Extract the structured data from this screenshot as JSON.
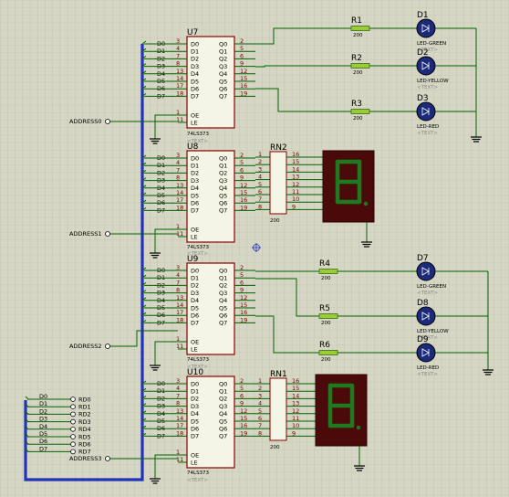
{
  "latches": [
    {
      "ref": "U7",
      "part": "74LS373",
      "text": "<TEXT>"
    },
    {
      "ref": "U8",
      "part": "74LS373",
      "text": "<TEXT>"
    },
    {
      "ref": "U9",
      "part": "74LS373",
      "text": "<TEXT>"
    },
    {
      "ref": "U10",
      "part": "74LS373",
      "text": "<TEXT>"
    }
  ],
  "latch_left_pins": [
    "D0",
    "D1",
    "D2",
    "D3",
    "D4",
    "D5",
    "D6",
    "D7"
  ],
  "latch_left_nums": [
    "3",
    "4",
    "7",
    "8",
    "13",
    "14",
    "17",
    "18"
  ],
  "latch_right_pins": [
    "Q0",
    "Q1",
    "Q2",
    "Q3",
    "Q4",
    "Q5",
    "Q6",
    "Q7"
  ],
  "latch_right_nums": [
    "2",
    "5",
    "6",
    "9",
    "12",
    "15",
    "16",
    "19"
  ],
  "oe_label": "OE",
  "le_label": "LE",
  "oe_num": "1",
  "le_num": "11",
  "bus_labels_u7": [
    "D0",
    "D1",
    "D2",
    "D3",
    "D4",
    "D5",
    "D6",
    "D7"
  ],
  "bus_labels_u8": [
    "D0",
    "D1",
    "D2",
    "D3",
    "D4",
    "D5",
    "D6",
    "D7"
  ],
  "bus_labels_u9": [
    "D0",
    "D1",
    "D2",
    "D3",
    "D4",
    "D5",
    "D6",
    "D7"
  ],
  "bus_labels_u10": [
    "D0",
    "D1",
    "D2",
    "D3",
    "D4",
    "D5",
    "D6",
    "D7"
  ],
  "address_labels": [
    "ADDRESS0",
    "ADDRESS1",
    "ADDRESS2",
    "ADDRESS3"
  ],
  "resistors": [
    {
      "ref": "R1",
      "value": "200"
    },
    {
      "ref": "R2",
      "value": "200"
    },
    {
      "ref": "R3",
      "value": "200"
    },
    {
      "ref": "R4",
      "value": "200"
    },
    {
      "ref": "R5",
      "value": "200"
    },
    {
      "ref": "R6",
      "value": "200"
    }
  ],
  "leds": [
    {
      "ref": "D1",
      "part": "LED-GREEN",
      "text": "<TEXT>",
      "color": "#1c2a7a"
    },
    {
      "ref": "D2",
      "part": "LED-YELLOW",
      "text": "<TEXT>",
      "color": "#1c2a7a"
    },
    {
      "ref": "D3",
      "part": "LED-RED",
      "text": "<TEXT>",
      "color": "#1c2a7a"
    },
    {
      "ref": "D7",
      "part": "LED-GREEN",
      "text": "<TEXT>",
      "color": "#1c2a7a"
    },
    {
      "ref": "D8",
      "part": "LED-YELLOW",
      "text": "<TEXT>",
      "color": "#1c2a7a"
    },
    {
      "ref": "D9",
      "part": "LED-RED",
      "text": "<TEXT>",
      "color": "#1c2a7a"
    }
  ],
  "networks": [
    {
      "ref": "RN2",
      "value": "200"
    },
    {
      "ref": "RN1",
      "value": "200"
    }
  ],
  "rn_left_nums": [
    "1",
    "2",
    "3",
    "4",
    "5",
    "6",
    "7",
    "8"
  ],
  "rn_right_nums": [
    "16",
    "15",
    "14",
    "13",
    "12",
    "11",
    "10",
    "9"
  ],
  "displays": [
    {
      "digit": "8"
    },
    {
      "digit": "8"
    }
  ],
  "connector_signals": [
    "D0",
    "D1",
    "D2",
    "D3",
    "D4",
    "D5",
    "D6",
    "D7"
  ],
  "connector_pins": [
    "RD0",
    "RD1",
    "RD2",
    "RD3",
    "RD4",
    "RD5",
    "RD6",
    "RD7"
  ],
  "colors": {
    "background": "#d6d6c4",
    "grid": "#b9b9a6",
    "wire": "#006400",
    "bus": "#2233bb",
    "body": "#f5f5e6",
    "body_border": "#8b0000",
    "display_bg": "#4a0a0a",
    "segment": "#1f7a1f",
    "resistor": "#9acd32",
    "led": "#1c2a7a"
  }
}
